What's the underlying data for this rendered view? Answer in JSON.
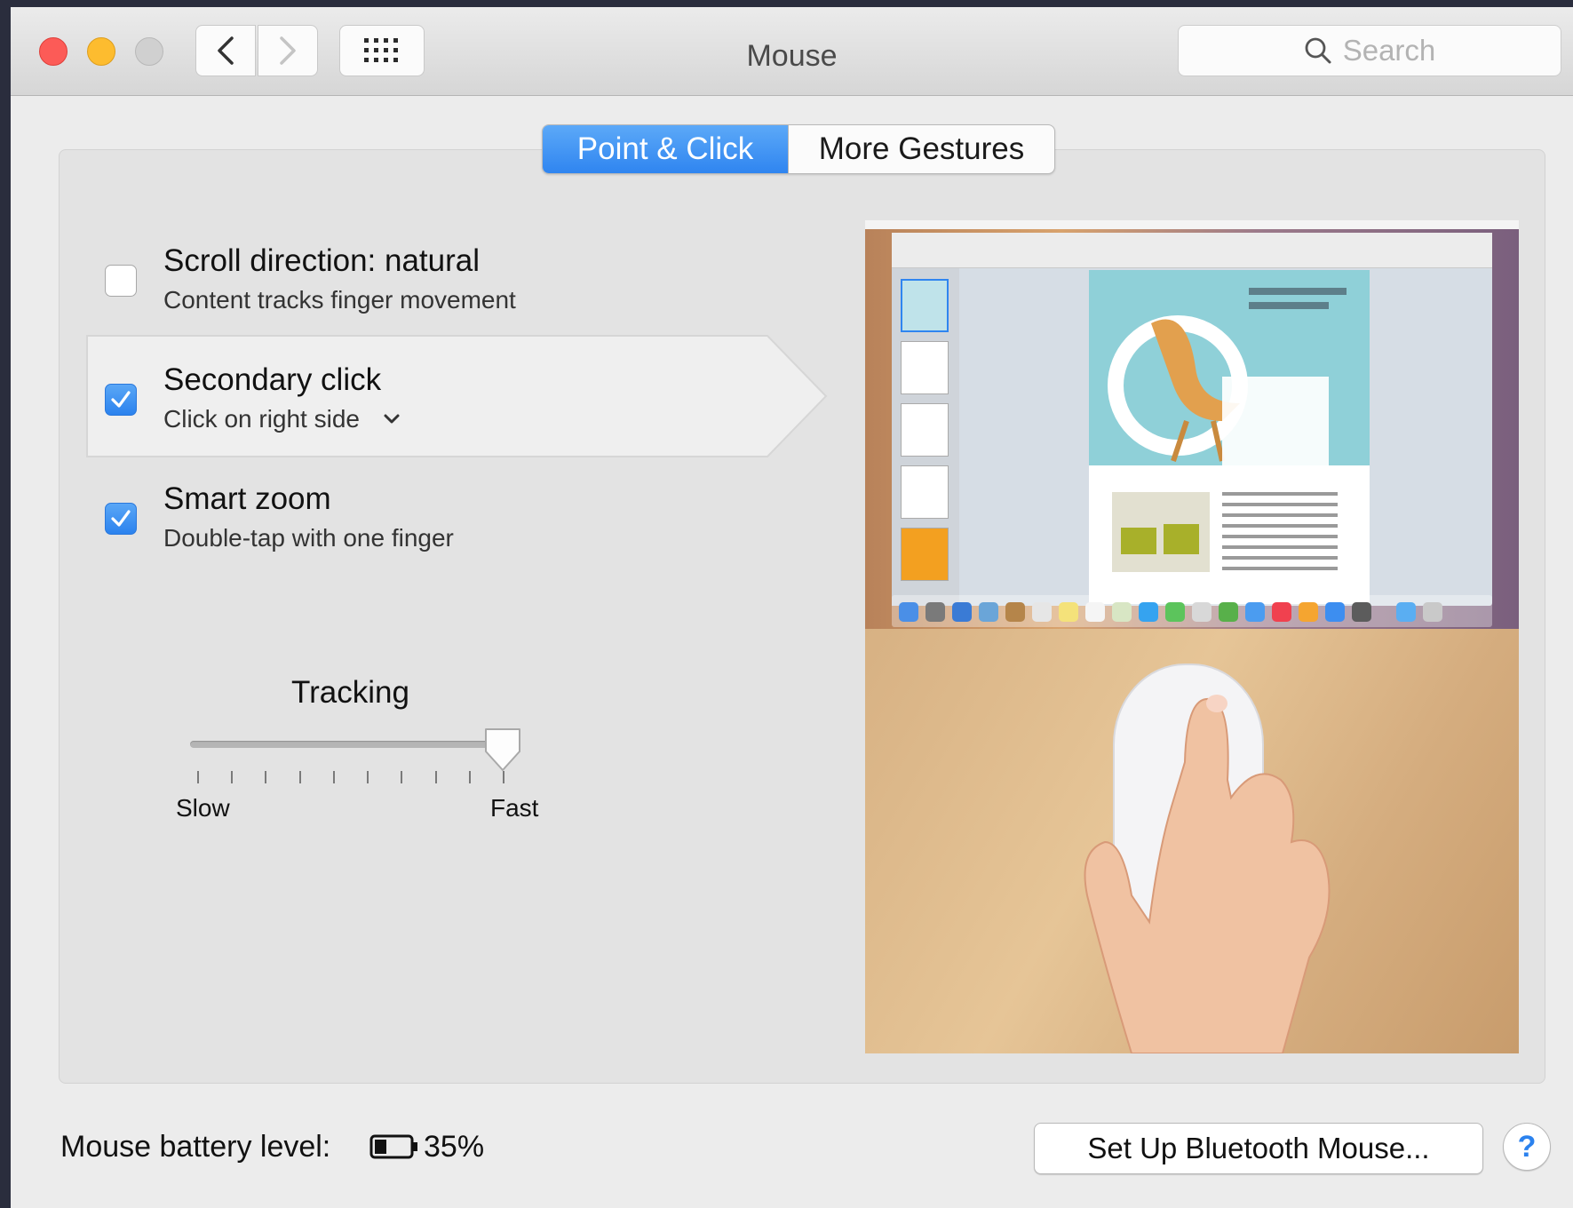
{
  "window": {
    "title": "Mouse"
  },
  "search": {
    "placeholder": "Search"
  },
  "tabs": [
    {
      "label": "Point & Click",
      "selected": true
    },
    {
      "label": "More Gestures",
      "selected": false
    }
  ],
  "options": [
    {
      "title": "Scroll direction: natural",
      "subtitle": "Content tracks finger movement",
      "checked": false
    },
    {
      "title": "Secondary click",
      "subtitle": "Click on right side",
      "checked": true
    },
    {
      "title": "Smart zoom",
      "subtitle": "Double-tap with one finger",
      "checked": true
    }
  ],
  "tracking": {
    "label": "Tracking",
    "min_label": "Slow",
    "max_label": "Fast",
    "level": 1.0,
    "tick_count": 10
  },
  "footer": {
    "battery_label": "Mouse battery level:",
    "battery_value": "35%",
    "battery_level": 0.35,
    "setup_button": "Set Up Bluetooth Mouse...",
    "help_button": "?"
  },
  "icons": {
    "back": "chevron-left-icon",
    "forward": "chevron-right-icon",
    "grid": "grid-icon",
    "search": "search-icon",
    "checkmark": "checkmark-icon",
    "dropdown": "chevron-down-icon",
    "battery": "battery-icon"
  },
  "colors": {
    "accent": "#2f85f0",
    "close": "#fc5b57",
    "minimize": "#fdbc2f",
    "maximize": "#d0d0d0"
  }
}
